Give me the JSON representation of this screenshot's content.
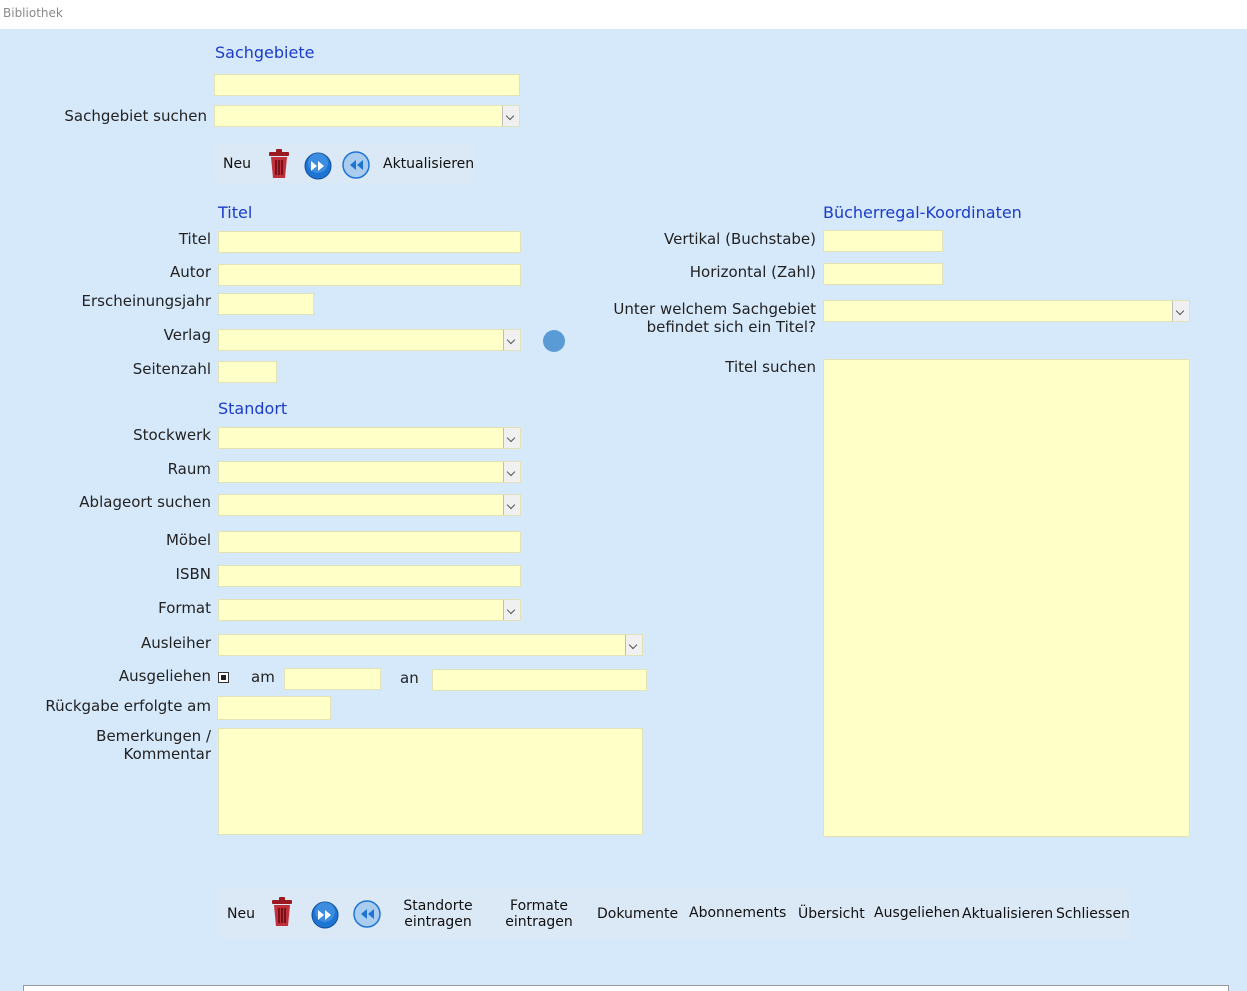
{
  "window": {
    "title": "Bibliothek"
  },
  "sections": {
    "sachgebiete": "Sachgebiete",
    "titel": "Titel",
    "standort": "Standort",
    "regal": "Bücherregal-Koordinaten"
  },
  "labels": {
    "sachgebiet_suchen": "Sachgebiet suchen",
    "titel": "Titel",
    "autor": "Autor",
    "erscheinungsjahr": "Erscheinungsjahr",
    "verlag": "Verlag",
    "seitenzahl": "Seitenzahl",
    "stockwerk": "Stockwerk",
    "raum": "Raum",
    "ablageort": "Ablageort suchen",
    "moebel": "Möbel",
    "isbn": "ISBN",
    "format": "Format",
    "ausleiher": "Ausleiher",
    "ausgeliehen": "Ausgeliehen",
    "am": "am",
    "an": "an",
    "rueckgabe": "Rückgabe erfolgte am",
    "bemerkungen_1": "Bemerkungen /",
    "bemerkungen_2": "Kommentar",
    "vertikal": "Vertikal (Buchstabe)",
    "horizontal": "Horizontal (Zahl)",
    "unter_sachgebiet_1": "Unter welchem Sachgebiet",
    "unter_sachgebiet_2": "befindet sich ein Titel?",
    "titel_suchen": "Titel suchen"
  },
  "toolbar_top": {
    "neu": "Neu",
    "aktualisieren": "Aktualisieren",
    "icons": [
      "trash-icon",
      "next-record-icon",
      "previous-record-icon"
    ]
  },
  "toolbar_bottom": {
    "neu": "Neu",
    "standorte_1": "Standorte",
    "standorte_2": "eintragen",
    "formate_1": "Formate",
    "formate_2": "eintragen",
    "dokumente": "Dokumente",
    "abonnements": "Abonnements",
    "uebersicht": "Übersicht",
    "ausgeliehen": "Ausgeliehen",
    "aktualisieren": "Aktualisieren",
    "schliessen": "Schliessen"
  },
  "fields": {
    "ausgeliehen_checked": true
  },
  "colors": {
    "form_bg": "#d6e9fb",
    "field_bg": "#ffffc8",
    "section_text": "#1a3cc8"
  }
}
